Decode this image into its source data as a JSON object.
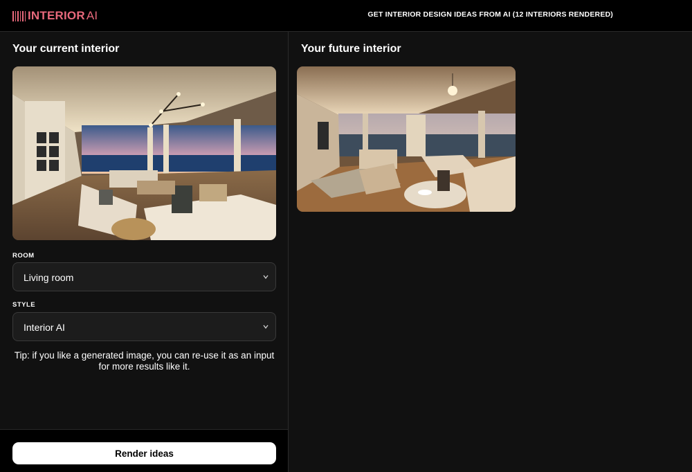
{
  "header": {
    "logo_text": "INTERIOR",
    "logo_suffix": "AI",
    "title": "GET INTERIOR DESIGN IDEAS FROM AI (12 INTERIORS RENDERED)"
  },
  "left": {
    "title": "Your current interior",
    "room": {
      "label": "ROOM",
      "value": "Living room"
    },
    "style": {
      "label": "STYLE",
      "value": "Interior AI"
    },
    "tip": "Tip: if you like a generated image, you can re-use it as an input for more results like it.",
    "render_button": "Render ideas"
  },
  "right": {
    "title": "Your future interior"
  },
  "colors": {
    "brand": "#e8697c",
    "background": "#111111",
    "header": "#000000",
    "button_bg": "#ffffff"
  },
  "icons": [
    "logo-bars-icon",
    "chevron-down-icon"
  ]
}
